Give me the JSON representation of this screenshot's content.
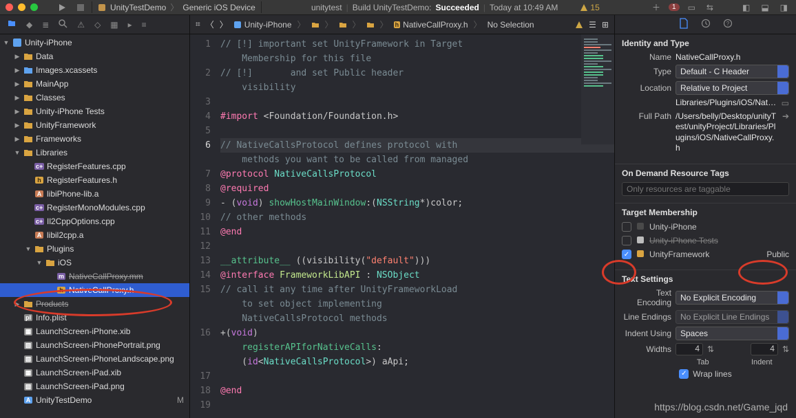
{
  "titlebar": {
    "scheme_target": "UnityTestDemo",
    "scheme_device": "Generic iOS Device",
    "status_app": "unitytest",
    "status_action": "Build UnityTestDemo:",
    "status_result": "Succeeded",
    "status_time": "Today at 10:49 AM",
    "warn_count": "15",
    "error_count": "1"
  },
  "jumpbar": {
    "root": "Unity-iPhone",
    "file": "NativeCallProxy.h",
    "selection": "No Selection"
  },
  "tree": [
    {
      "d": 0,
      "kind": "proj",
      "open": true,
      "name": "Unity-iPhone"
    },
    {
      "d": 1,
      "kind": "folder",
      "open": false,
      "name": "Data"
    },
    {
      "d": 1,
      "kind": "folder-blue",
      "open": false,
      "name": "Images.xcassets"
    },
    {
      "d": 1,
      "kind": "folder",
      "open": false,
      "name": "MainApp"
    },
    {
      "d": 1,
      "kind": "folder",
      "open": false,
      "name": "Classes"
    },
    {
      "d": 1,
      "kind": "folder",
      "open": false,
      "name": "Unity-iPhone Tests"
    },
    {
      "d": 1,
      "kind": "folder",
      "open": false,
      "name": "UnityFramework"
    },
    {
      "d": 1,
      "kind": "folder",
      "open": false,
      "name": "Frameworks"
    },
    {
      "d": 1,
      "kind": "folder",
      "open": true,
      "name": "Libraries"
    },
    {
      "d": 2,
      "kind": "cpp",
      "name": "RegisterFeatures.cpp"
    },
    {
      "d": 2,
      "kind": "h",
      "name": "RegisterFeatures.h"
    },
    {
      "d": 2,
      "kind": "a",
      "name": "libiPhone-lib.a"
    },
    {
      "d": 2,
      "kind": "cpp",
      "name": "RegisterMonoModules.cpp"
    },
    {
      "d": 2,
      "kind": "cpp",
      "name": "Il2CppOptions.cpp"
    },
    {
      "d": 2,
      "kind": "a",
      "name": "libil2cpp.a"
    },
    {
      "d": 2,
      "kind": "folder",
      "open": true,
      "name": "Plugins"
    },
    {
      "d": 3,
      "kind": "folder",
      "open": true,
      "name": "iOS"
    },
    {
      "d": 4,
      "kind": "mm",
      "name": "NativeCallProxy.mm",
      "strike": true
    },
    {
      "d": 4,
      "kind": "h",
      "name": "NativeCallProxy.h",
      "selected": true
    },
    {
      "d": 1,
      "kind": "folder",
      "open": false,
      "name": "Products",
      "strike": true
    },
    {
      "d": 1,
      "kind": "plist",
      "name": "Info.plist"
    },
    {
      "d": 1,
      "kind": "xib",
      "name": "LaunchScreen-iPhone.xib"
    },
    {
      "d": 1,
      "kind": "img",
      "name": "LaunchScreen-iPhonePortrait.png"
    },
    {
      "d": 1,
      "kind": "img",
      "name": "LaunchScreen-iPhoneLandscape.png"
    },
    {
      "d": 1,
      "kind": "xib",
      "name": "LaunchScreen-iPad.xib"
    },
    {
      "d": 1,
      "kind": "img",
      "name": "LaunchScreen-iPad.png"
    },
    {
      "d": 1,
      "kind": "app",
      "name": "UnityTestDemo",
      "mod": "M"
    }
  ],
  "code": {
    "lines": [
      [
        [
          "// [!] important set UnityFramework in Target Membership for this file",
          "comment"
        ]
      ],
      [
        [
          "// [!]       and set Public header visibility",
          "comment"
        ]
      ],
      [],
      [
        [
          "#import ",
          "keyword"
        ],
        [
          "<Foundation/Foundation.h>",
          "inc"
        ]
      ],
      [],
      [
        [
          "// NativeCallsProtocol defines protocol with methods you want to be called from managed",
          "comment"
        ]
      ],
      [
        [
          "@protocol ",
          "keyword"
        ],
        [
          "NativeCallsProtocol",
          "type"
        ]
      ],
      [
        [
          "@required",
          "keyword"
        ]
      ],
      [
        [
          "- (",
          "default"
        ],
        [
          "void",
          "kw2"
        ],
        [
          ") ",
          "default"
        ],
        [
          "showHostMainWindow",
          "funcdecl"
        ],
        [
          ":(",
          "default"
        ],
        [
          "NSString",
          "type"
        ],
        [
          "*)color;",
          "default"
        ]
      ],
      [
        [
          "// other methods",
          "comment"
        ]
      ],
      [
        [
          "@end",
          "keyword"
        ]
      ],
      [],
      [
        [
          "__attribute__ ",
          "funcdecl"
        ],
        [
          "((visibility(",
          "default"
        ],
        [
          "\"default\"",
          "string"
        ],
        [
          ")))",
          "default"
        ]
      ],
      [
        [
          "@interface ",
          "keyword"
        ],
        [
          "FrameworkLibAPI",
          "cls"
        ],
        [
          " : ",
          "default"
        ],
        [
          "NSObject",
          "type"
        ]
      ],
      [
        [
          "// call it any time after UnityFrameworkLoad to set object implementing NativeCallsProtocol methods",
          "comment"
        ]
      ],
      [
        [
          "+(",
          "default"
        ],
        [
          "void",
          "kw2"
        ],
        [
          ") ",
          "default"
        ],
        [
          "registerAPIforNativeCalls",
          "funcdecl"
        ],
        [
          ": (",
          "default"
        ],
        [
          "id",
          "kw2"
        ],
        [
          "<",
          "default"
        ],
        [
          "NativeCallsProtocol",
          "type"
        ],
        [
          ">) aApi;",
          "default"
        ]
      ],
      [],
      [
        [
          "@end",
          "keyword"
        ]
      ],
      []
    ],
    "display": [
      "// [!] important set UnityFramework in Target",
      "    Membership for this file",
      "// [!]       and set Public header",
      "    visibility",
      "",
      "#import <Foundation/Foundation.h>",
      "",
      "// NativeCallsProtocol defines protocol with",
      "    methods you want to be called from managed",
      "@protocol NativeCallsProtocol",
      "@required",
      "- (void) showHostMainWindow:(NSString*)color;",
      "// other methods",
      "@end",
      "",
      "__attribute__ ((visibility(\"default\")))",
      "@interface FrameworkLibAPI : NSObject",
      "// call it any time after UnityFrameworkLoad",
      "    to set object implementing",
      "    NativeCallsProtocol methods",
      "+(void)",
      "    registerAPIforNativeCalls:",
      "    (id<NativeCallsProtocol>) aApi;",
      "",
      "@end",
      ""
    ],
    "linemap": [
      1,
      null,
      2,
      null,
      3,
      4,
      5,
      6,
      null,
      7,
      8,
      9,
      10,
      11,
      12,
      13,
      14,
      15,
      null,
      null,
      16,
      null,
      null,
      17,
      18,
      19
    ],
    "current_line": 6
  },
  "inspector": {
    "identity_title": "Identity and Type",
    "name_label": "Name",
    "name_value": "NativeCallProxy.h",
    "type_label": "Type",
    "type_value": "Default - C Header",
    "location_label": "Location",
    "location_value": "Relative to Project",
    "location_path": "Libraries/Plugins/iOS/NativeCallProxy.h",
    "fullpath_label": "Full Path",
    "fullpath_value": "/Users/belly/Desktop/unityTest/unityProject/Libraries/Plugins/iOS/NativeCallProxy.h",
    "odr_title": "On Demand Resource Tags",
    "odr_placeholder": "Only resources are taggable",
    "targets_title": "Target Membership",
    "targets": [
      {
        "name": "Unity-iPhone",
        "checked": false,
        "icon": "app"
      },
      {
        "name": "Unity-iPhone Tests",
        "checked": false,
        "icon": "tests",
        "strike": true
      },
      {
        "name": "UnityFramework",
        "checked": true,
        "icon": "fw",
        "visibility": "Public"
      }
    ],
    "textset_title": "Text Settings",
    "encoding_label": "Text Encoding",
    "encoding_value": "No Explicit Encoding",
    "lineend_label": "Line Endings",
    "lineend_value": "No Explicit Line Endings",
    "indent_label": "Indent Using",
    "indent_value": "Spaces",
    "widths_label": "Widths",
    "tab_value": "4",
    "tab_label": "Tab",
    "indentw_value": "4",
    "indentw_label": "Indent",
    "wrap_label": "Wrap lines",
    "wrap_checked": true
  },
  "watermark": "https://blog.csdn.net/Game_jqd"
}
